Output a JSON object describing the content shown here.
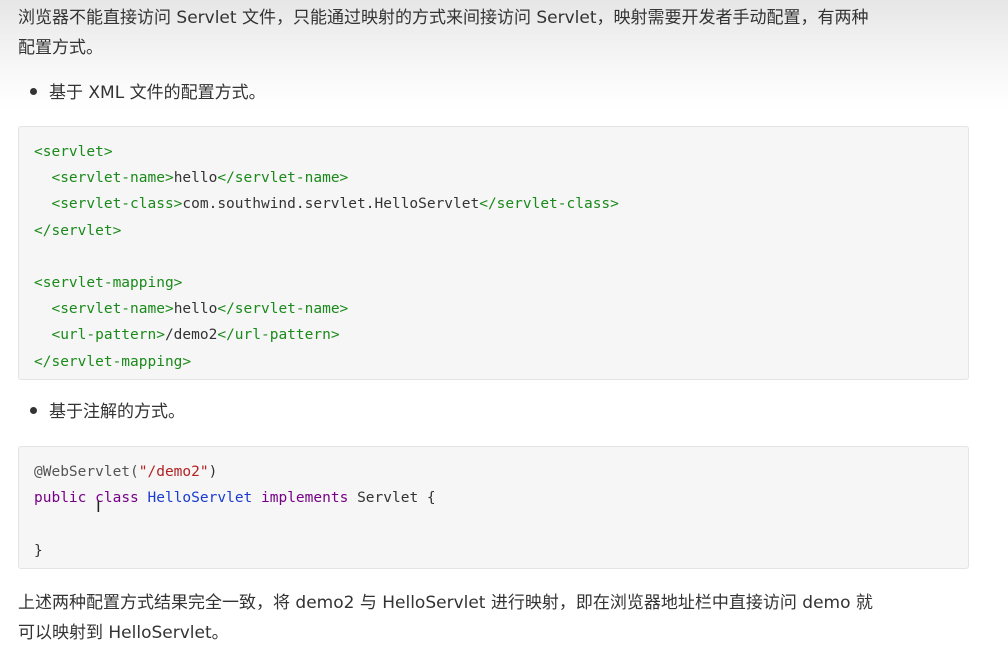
{
  "intro_line1": "浏览器不能直接访问 Servlet 文件，只能通过映射的方式来间接访问 Servlet，映射需要开发者手动配置，有两种",
  "intro_line2": "配置方式。",
  "bullet_xml": "基于 XML 文件的配置方式。",
  "xml_code": {
    "l1_tag": "<servlet>",
    "l2_open": "  <servlet-name>",
    "l2_val": "hello",
    "l2_close": "</servlet-name>",
    "l3_open": "  <servlet-class>",
    "l3_val": "com.southwind.servlet.HelloServlet",
    "l3_close": "</servlet-class>",
    "l4_tag": "</servlet>",
    "l6_tag": "<servlet-mapping>",
    "l7_open": "  <servlet-name>",
    "l7_val": "hello",
    "l7_close": "</servlet-name>",
    "l8_open": "  <url-pattern>",
    "l8_val": "/demo2",
    "l8_close": "</url-pattern>",
    "l9_tag": "</servlet-mapping>"
  },
  "bullet_annotation": "基于注解的方式。",
  "java_code": {
    "ann": "@WebServlet(",
    "ann_str": "\"/demo2\"",
    "ann_close": ")",
    "kw_public": "public",
    "kw_class": "class",
    "cls_name": "HelloServlet",
    "kw_implements": "implements",
    "iface": "Servlet {",
    "close": "}"
  },
  "outro_line1": "上述两种配置方式结果完全一致，将 demo2 与 HelloServlet 进行映射，即在浏览器地址栏中直接访问 demo 就",
  "outro_line2": "可以映射到 HelloServlet。"
}
